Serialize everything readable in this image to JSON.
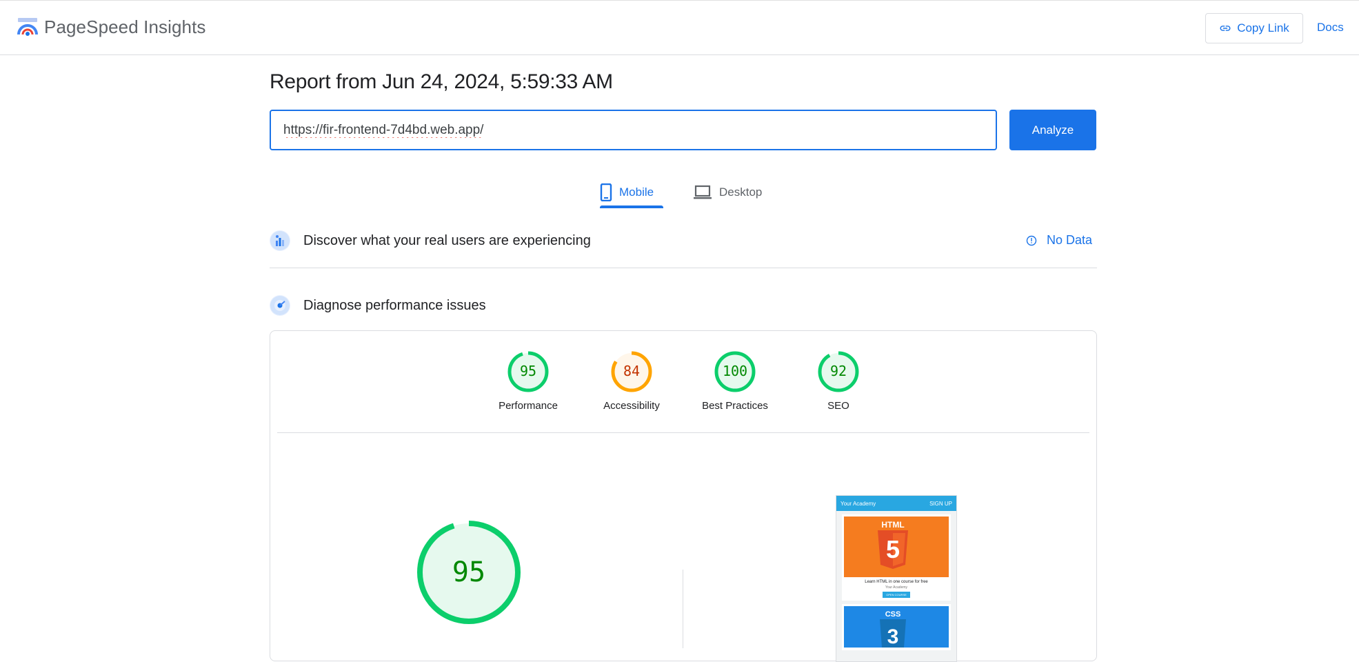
{
  "header": {
    "app_name": "PageSpeed Insights",
    "copy_link_label": "Copy Link",
    "docs_label": "Docs"
  },
  "report": {
    "title": "Report from Jun 24, 2024, 5:59:33 AM",
    "url_value": "https://fir-frontend-7d4bd.web.app/",
    "analyze_label": "Analyze"
  },
  "tabs": [
    {
      "label": "Mobile",
      "active": true
    },
    {
      "label": "Desktop",
      "active": false
    }
  ],
  "sections": {
    "real_users": {
      "title": "Discover what your real users are experiencing",
      "status": "No Data"
    },
    "diagnose": {
      "title": "Diagnose performance issues"
    }
  },
  "scores": [
    {
      "label": "Performance",
      "value": "95",
      "color": "#0cce6b",
      "text_color": "#008800",
      "fill": "#e6f9ee"
    },
    {
      "label": "Accessibility",
      "value": "84",
      "color": "#ffa400",
      "text_color": "#c33300",
      "fill": "#fff6ea"
    },
    {
      "label": "Best Practices",
      "value": "100",
      "color": "#0cce6b",
      "text_color": "#008800",
      "fill": "#e6f9ee"
    },
    {
      "label": "SEO",
      "value": "92",
      "color": "#0cce6b",
      "text_color": "#008800",
      "fill": "#e6f9ee"
    }
  ],
  "main_score": {
    "value": "95",
    "color": "#0cce6b"
  },
  "thumbnail": {
    "site_title": "Your Academy",
    "nav_label": "SIGN UP",
    "html_badge": "HTML",
    "html_digit": "5",
    "course_text": "Learn HTML in one course for free",
    "course_sub": "Your Academy",
    "course_btn": "OPEN COURSE",
    "css_badge": "CSS",
    "css_digit": "3"
  },
  "colors": {
    "accent": "#1a73e8",
    "pass": "#0cce6b",
    "average": "#ffa400"
  }
}
